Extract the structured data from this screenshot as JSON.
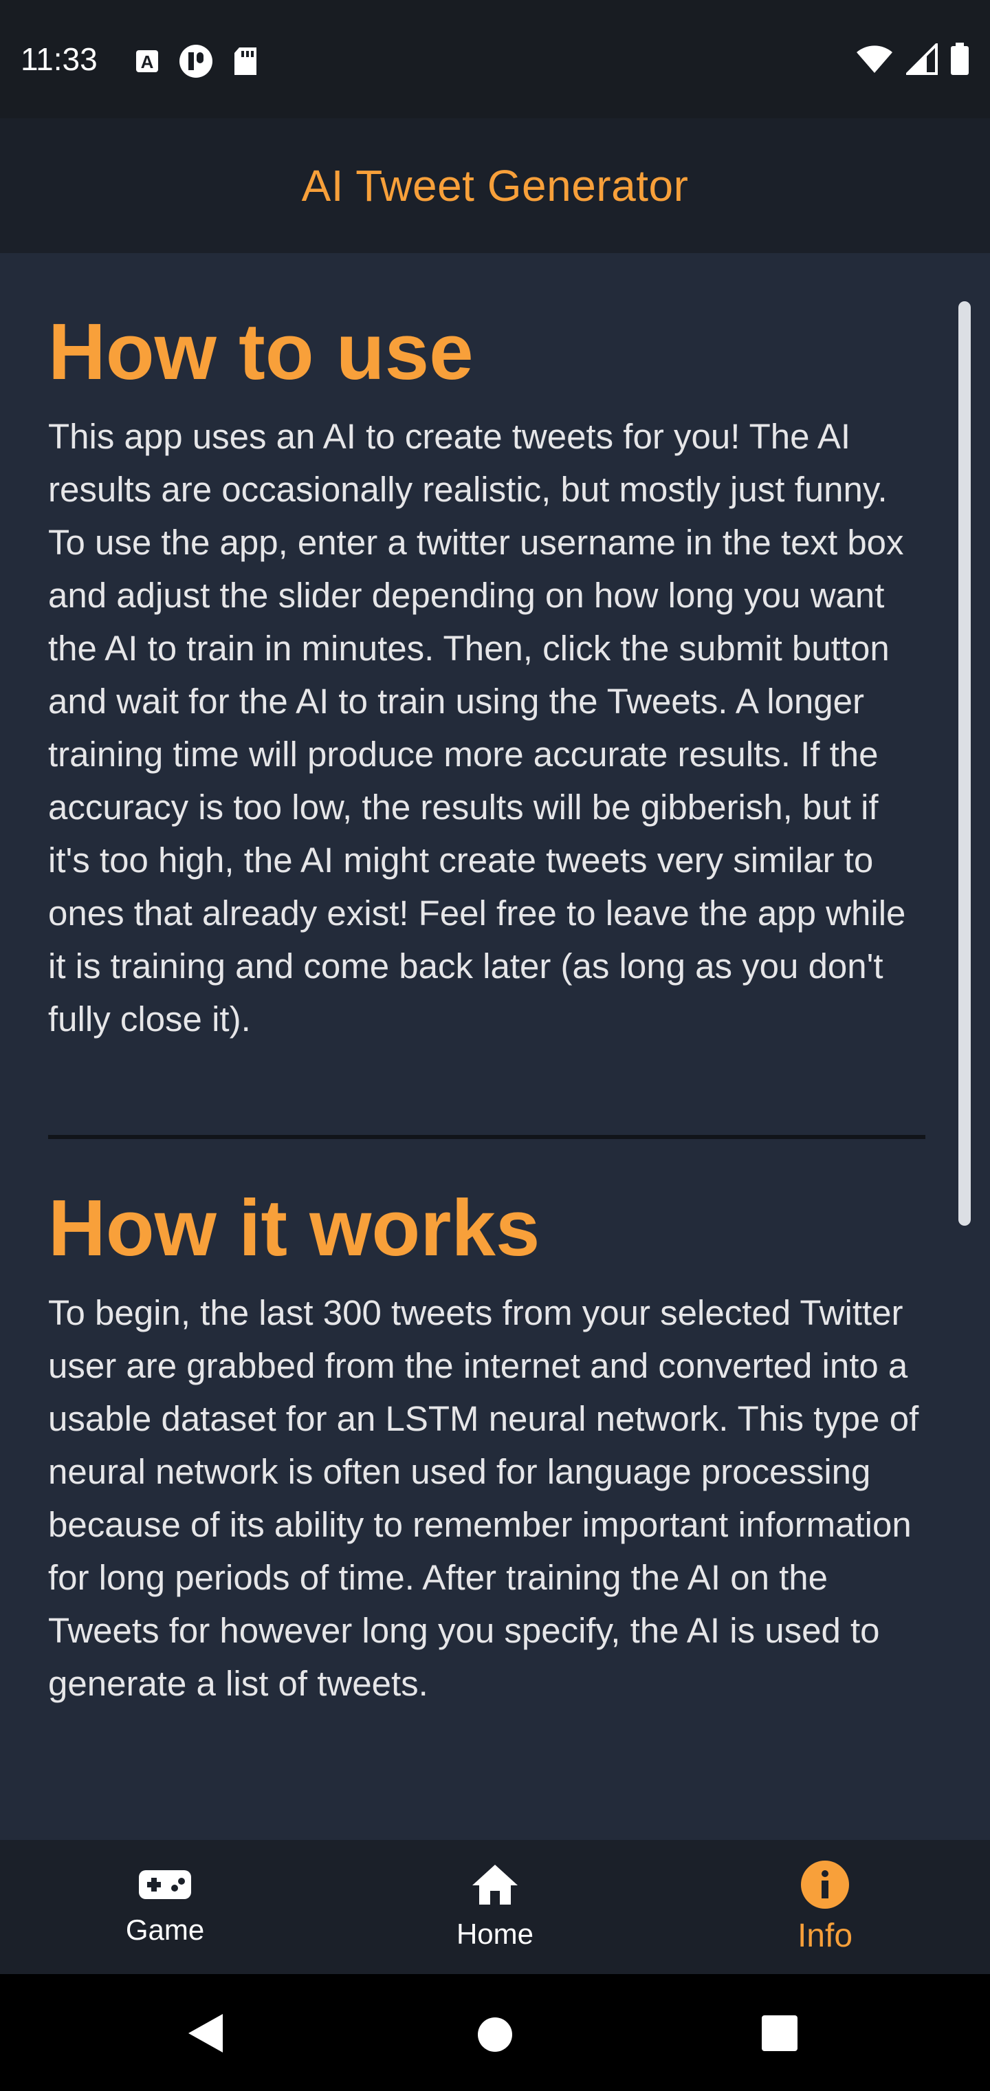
{
  "status_bar": {
    "time": "11:33",
    "icons_left": [
      "a-notification-icon",
      "circle-notification-icon",
      "sd-card-icon"
    ],
    "icons_right": [
      "wifi-icon",
      "signal-icon",
      "battery-icon"
    ]
  },
  "app_bar": {
    "title": "AI Tweet Generator"
  },
  "sections": [
    {
      "heading": "How to use",
      "body": "This app uses an AI to create tweets for you! The AI results are occasionally realistic, but mostly just funny. To use the app, enter a twitter username in the text box and adjust the slider depending on how long you want the AI to train in minutes. Then, click the submit button and wait for the AI to train using the Tweets. A longer training time will produce more accurate results. If the accuracy is too low, the results will be gibberish, but if it's too high, the AI might create tweets very similar to ones that already exist! Feel free to leave the app while it is training and come back later (as long as you don't fully close it)."
    },
    {
      "heading": "How it works",
      "body": "To begin, the last 300 tweets from your selected Twitter user are grabbed from the internet and converted into a usable dataset for an LSTM neural network. This type of neural network is often used for language processing because of its ability to remember important information for long periods of time. After training the AI on the Tweets for however long you specify, the AI is used to generate a list of tweets."
    }
  ],
  "bottom_nav": {
    "items": [
      {
        "label": "Game",
        "icon": "gamepad-icon",
        "active": false
      },
      {
        "label": "Home",
        "icon": "home-icon",
        "active": false
      },
      {
        "label": "Info",
        "icon": "info-icon",
        "active": true
      }
    ]
  },
  "colors": {
    "accent": "#f8a03a",
    "background": "#232b3a",
    "bar": "#1b2029",
    "text": "#e6e6e8"
  }
}
